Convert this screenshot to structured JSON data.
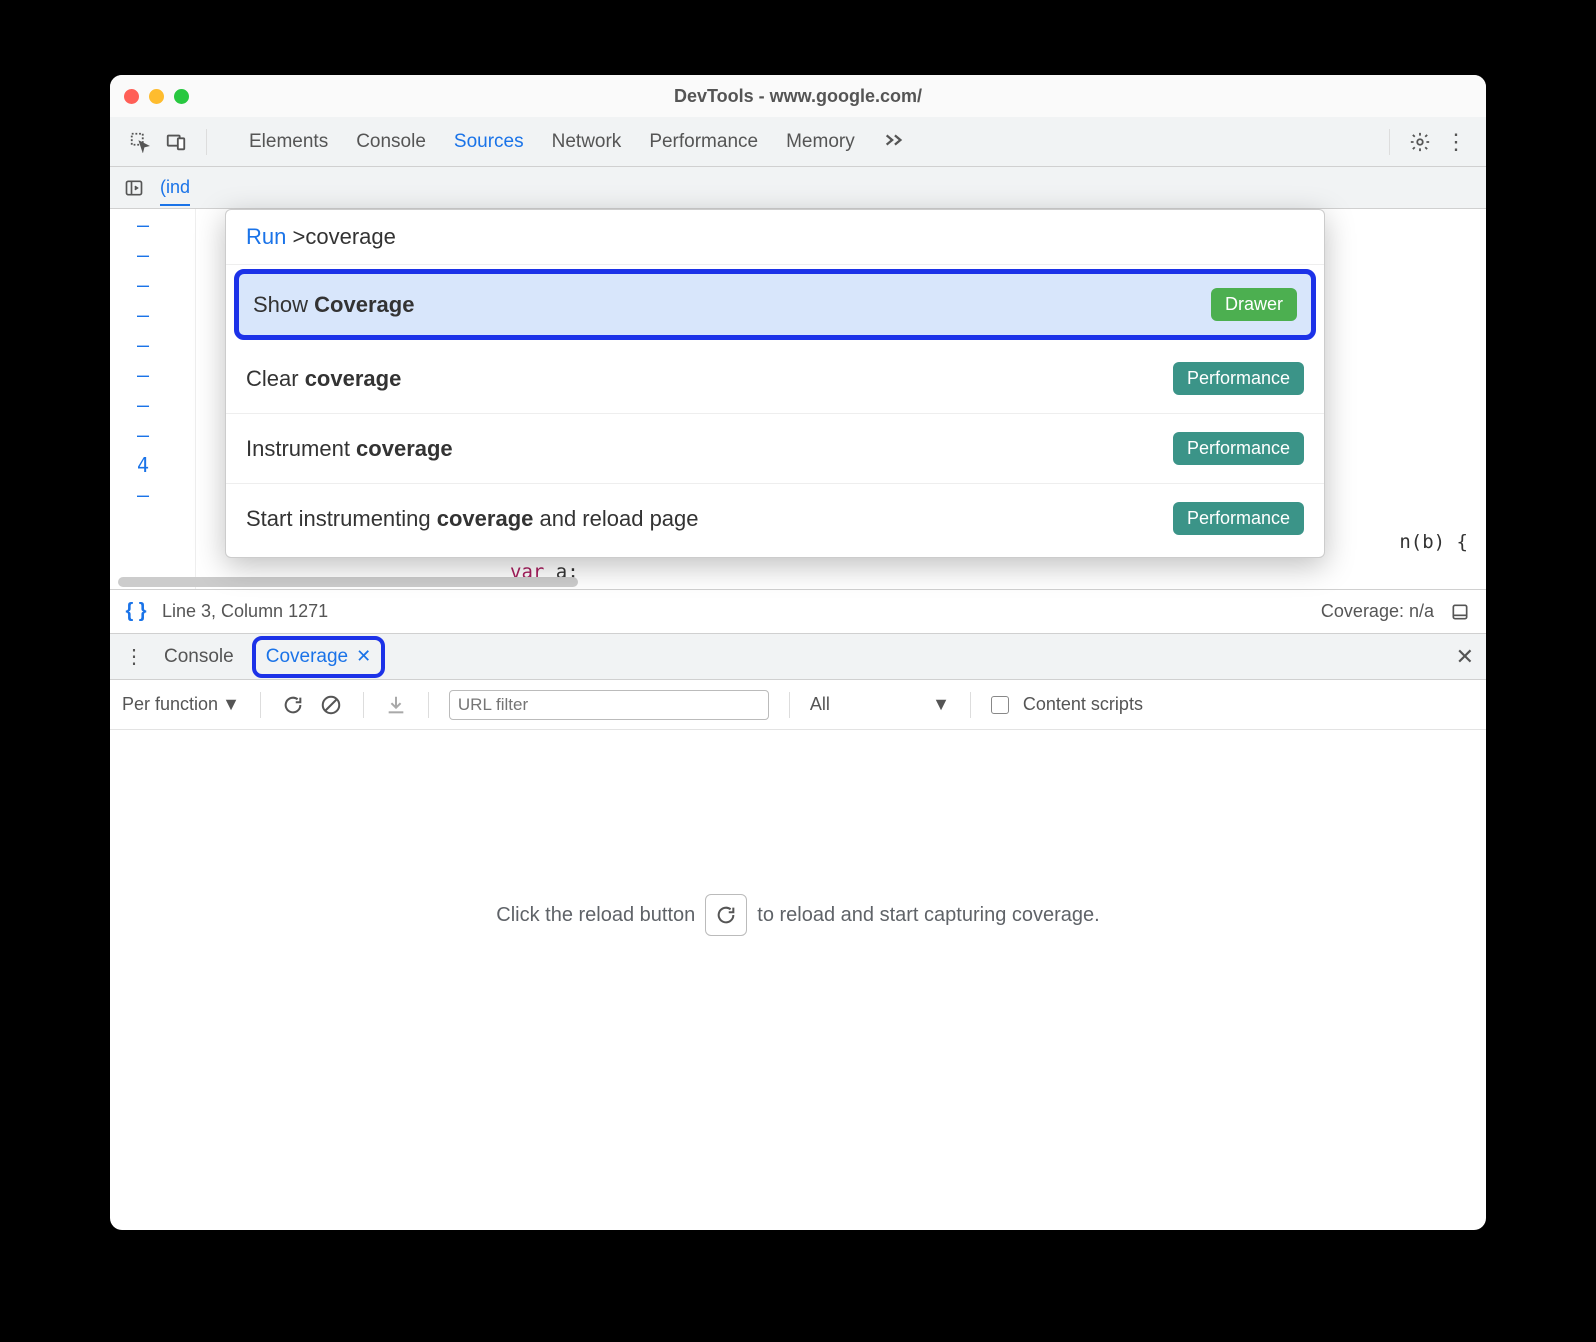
{
  "window": {
    "title": "DevTools - www.google.com/"
  },
  "tabs": {
    "items": [
      "Elements",
      "Console",
      "Sources",
      "Network",
      "Performance",
      "Memory"
    ],
    "active": "Sources"
  },
  "source": {
    "file_tab": "(ind",
    "gutter": [
      "–",
      "–",
      "–",
      "–",
      "–",
      "–",
      "–",
      "–",
      "4",
      "–"
    ],
    "code_line_right": "n(b) {",
    "code_line_var": "var",
    "code_line_a": " a;"
  },
  "command_menu": {
    "prefix": "Run ",
    "caret": ">",
    "query": "coverage",
    "items": [
      {
        "pre": "Show ",
        "match": "Coverage",
        "post": "",
        "badge": "Drawer",
        "badge_type": "drawer",
        "selected": true
      },
      {
        "pre": "Clear ",
        "match": "coverage",
        "post": "",
        "badge": "Performance",
        "badge_type": "perf",
        "selected": false
      },
      {
        "pre": "Instrument ",
        "match": "coverage",
        "post": "",
        "badge": "Performance",
        "badge_type": "perf",
        "selected": false
      },
      {
        "pre": "Start instrumenting ",
        "match": "coverage",
        "post": " and reload page",
        "badge": "Performance",
        "badge_type": "perf",
        "selected": false
      }
    ]
  },
  "status": {
    "position": "Line 3, Column 1271",
    "coverage": "Coverage: n/a"
  },
  "drawer": {
    "tabs": {
      "console": "Console",
      "coverage": "Coverage"
    },
    "toolbar": {
      "granularity": "Per function",
      "url_filter_placeholder": "URL filter",
      "type_filter": "All",
      "content_scripts": "Content scripts"
    },
    "body": {
      "pre": "Click the reload button",
      "post": "to reload and start capturing coverage."
    }
  }
}
